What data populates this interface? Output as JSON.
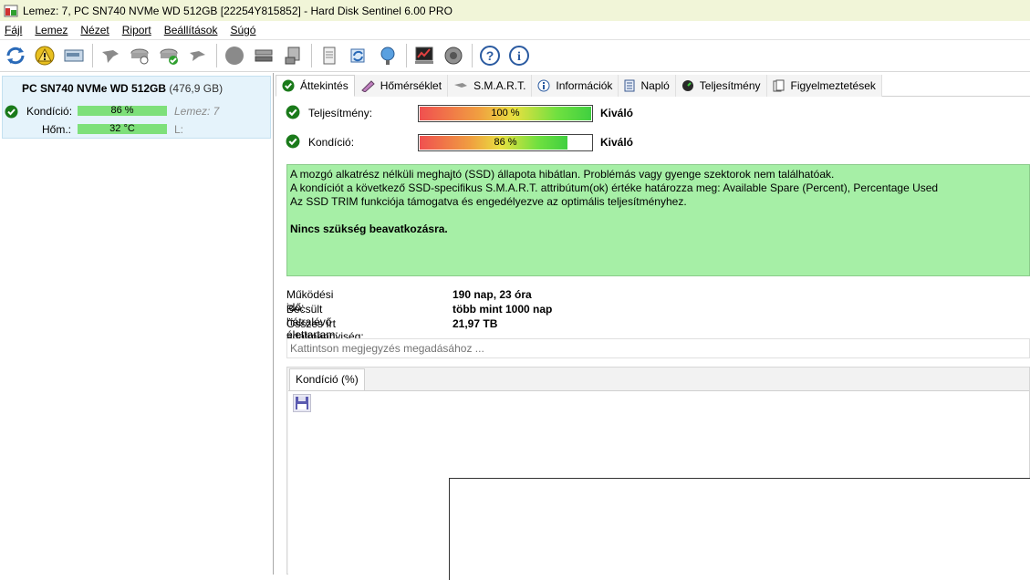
{
  "window": {
    "title": "Lemez: 7, PC SN740 NVMe WD 512GB [22254Y815852]  -  Hard Disk Sentinel 6.00 PRO"
  },
  "menu": [
    {
      "label": "Fájl"
    },
    {
      "label": "Lemez"
    },
    {
      "label": "Nézet"
    },
    {
      "label": "Riport"
    },
    {
      "label": "Beállítások"
    },
    {
      "label": "Súgó"
    }
  ],
  "toolbar_icons": [
    "refresh-icon",
    "alert-icon",
    "disk-icon",
    "disk-grey-icon",
    "disk-check-icon",
    "disk-ok-icon",
    "disk-tool-icon",
    "circle-icon",
    "drive-stack-icon",
    "drive-icon",
    "report-icon",
    "sync-icon",
    "network-icon",
    "chart-icon",
    "sound-icon",
    "help-icon",
    "info-icon"
  ],
  "disk": {
    "name": "PC SN740 NVMe WD 512GB",
    "size": "(476,9 GB)",
    "condition_label": "Kondíció:",
    "condition_value": "86 %",
    "condition_fraction": 0.86,
    "temp_label": "Hőm.:",
    "temp_value": "32 °C",
    "disk_label": "Lemez: 7",
    "drive_letter": "L:"
  },
  "tabs": [
    {
      "label": "Áttekintés",
      "icon": "check-icon"
    },
    {
      "label": "Hőmérséklet",
      "icon": "thermometer-icon"
    },
    {
      "label": "S.M.A.R.T.",
      "icon": "smart-icon"
    },
    {
      "label": "Információk",
      "icon": "info-icon"
    },
    {
      "label": "Napló",
      "icon": "log-icon"
    },
    {
      "label": "Teljesítmény",
      "icon": "gauge-icon"
    },
    {
      "label": "Figyelmeztetések",
      "icon": "warnings-icon"
    }
  ],
  "performance": {
    "label": "Teljesítmény:",
    "value": "100 %",
    "fraction": 1.0,
    "verdict": "Kiváló"
  },
  "health": {
    "label": "Kondíció:",
    "value": "86 %",
    "fraction": 0.86,
    "verdict": "Kiváló"
  },
  "info_text": {
    "line1": "A mozgó alkatrész nélküli meghajtó (SSD) állapota hibátlan. Problémás vagy gyenge szektorok nem találhatóak.",
    "line2": "A kondíciót a következő SSD-specifikus S.M.A.R.T. attribútum(ok) értéke határozza meg:  Available Spare (Percent), Percentage Used",
    "line3": "Az SSD TRIM funkciója támogatva és engedélyezve az optimális teljesítményhez.",
    "action": "Nincs szükség beavatkozásra."
  },
  "stats": [
    {
      "key": "Működési idő:",
      "value": "190 nap, 23 óra"
    },
    {
      "key": "Becsült hátralévő élettartam:",
      "value": "több mint 1000 nap"
    },
    {
      "key": "Összes írt adatmennyiség:",
      "value": "21,97 TB"
    }
  ],
  "note": {
    "placeholder": "Kattintson megjegyzés megadásához ..."
  },
  "chart_tab": {
    "label": "Kondíció  (%)"
  },
  "colors": {
    "titlebar_bg": "#f1f5d8",
    "info_bg": "#a6efa6",
    "selected_disk_bg": "#e5f3fb",
    "bar_green": "#7ee07a"
  }
}
